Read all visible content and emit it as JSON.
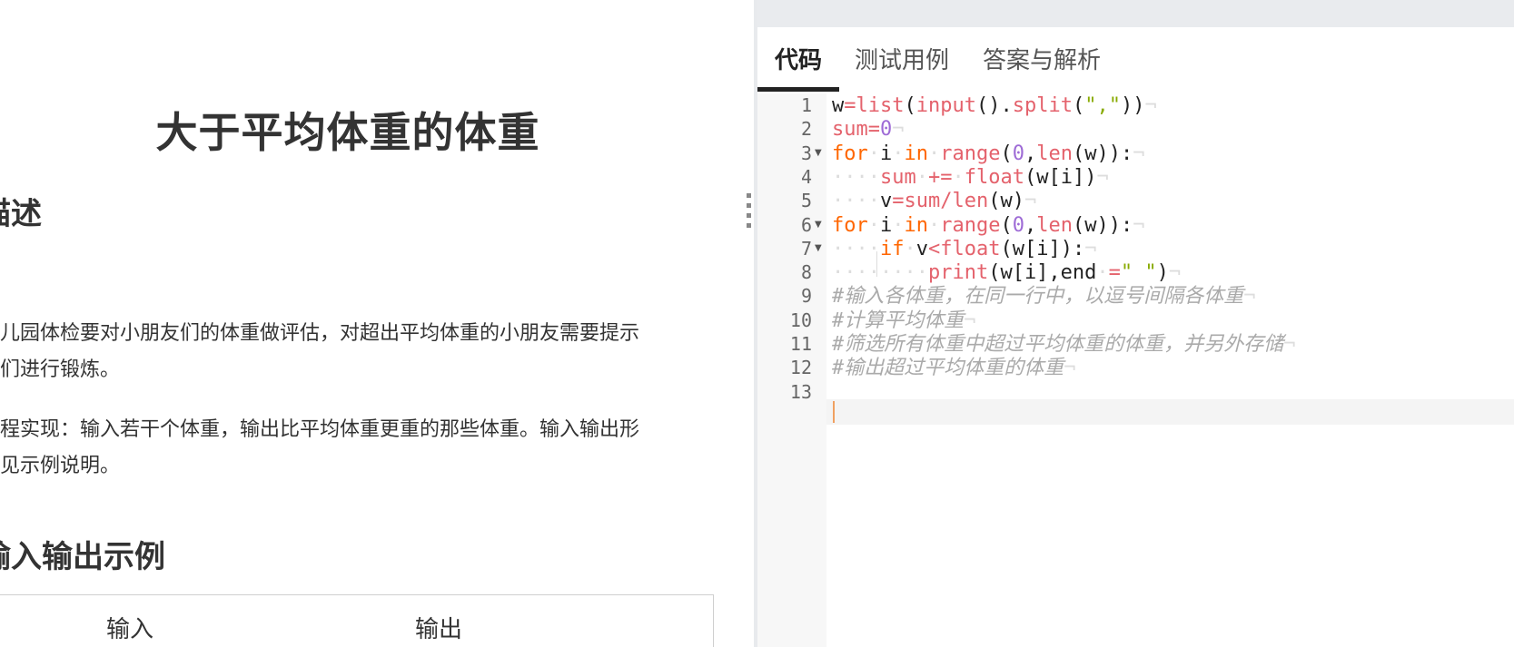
{
  "problem": {
    "title": "大于平均体重的体重",
    "section_description": "描述",
    "paragraph1_line1": "幼儿园体检要对小朋友们的体重做评估，对超出平均体重的小朋友需要提示",
    "paragraph1_line2": "他们进行锻炼。",
    "paragraph2_line1": "编程实现：输入若干个体重，输出比平均体重更重的那些体重。输入输出形",
    "paragraph2_line2": "式见示例说明。",
    "section_examples": "输入输出示例",
    "table_headers": [
      "输入",
      "输出"
    ]
  },
  "editor": {
    "tabs": [
      {
        "label": "代码",
        "active": true
      },
      {
        "label": "测试用例",
        "active": false
      },
      {
        "label": "答案与解析",
        "active": false
      }
    ],
    "line_numbers": [
      "1",
      "2",
      "3",
      "4",
      "5",
      "6",
      "7",
      "8",
      "9",
      "10",
      "11",
      "12",
      "13"
    ],
    "fold_markers": [
      "3",
      "6",
      "7"
    ],
    "code_lines": [
      "w=list(input().split(\",\"))",
      "sum=0",
      "for i in range(0,len(w)):",
      "    sum += float(w[i])",
      "    v=sum/len(w)",
      "for i in range(0,len(w)):",
      "    if v<float(w[i]):",
      "        print(w[i],end =\" \")",
      "#输入各体重，在同一行中，以逗号间隔各体重",
      "#计算平均体重",
      "#筛选所有体重中超过平均体重的体重，并另外存储",
      "#输出超过平均体重的体重",
      ""
    ],
    "active_line": 13
  },
  "colors": {
    "keyword": "#ff6600",
    "builtin": "#e4626c",
    "string": "#88aa00",
    "number": "#9e6bd6",
    "comment": "#aaaaaa",
    "tab_underline": "#222222",
    "gutter_bg": "#f7f7f7",
    "topbar_bg": "#e9ebee"
  },
  "icons": {
    "fold": "fold-arrow-icon",
    "splitter": "drag-handle-icon"
  }
}
